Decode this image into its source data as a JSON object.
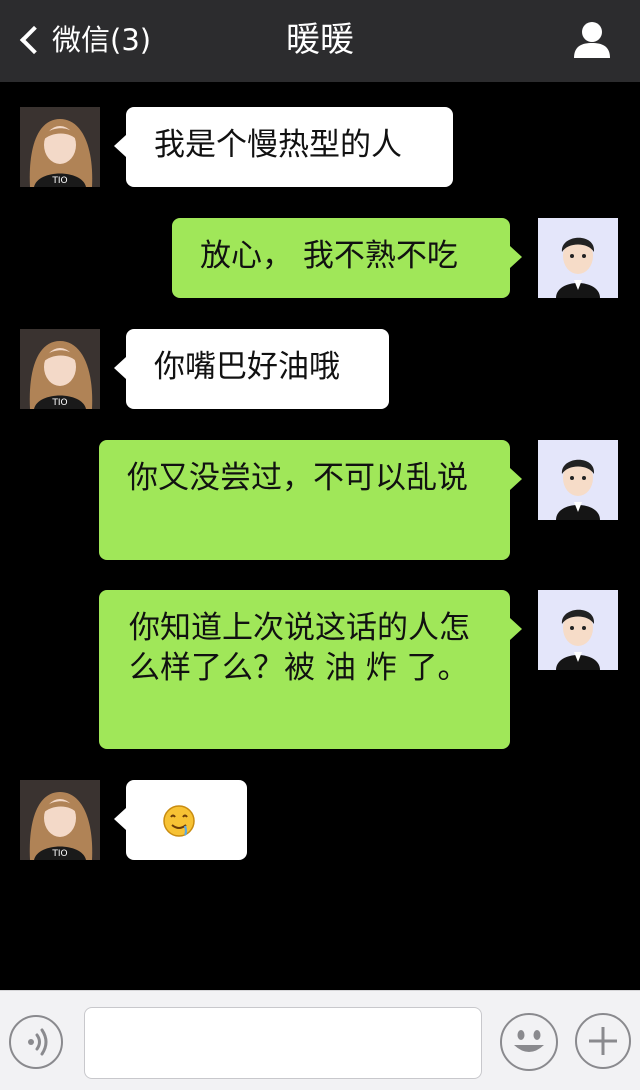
{
  "header": {
    "back_label": "微信(3)",
    "title": "暖暖",
    "profile_icon": "person-icon"
  },
  "messages": [
    {
      "side": "left",
      "text": "我是个慢热型的人"
    },
    {
      "side": "right",
      "text": "放心， 我不熟不吃"
    },
    {
      "side": "left",
      "text": "你嘴巴好油哦"
    },
    {
      "side": "right",
      "text": "你又没尝过，不可以乱说"
    },
    {
      "side": "right",
      "text": "你知道上次说这话的人怎么样了么？被 油 炸 了。"
    },
    {
      "side": "left",
      "emoji": "drooling-face-emoji"
    }
  ],
  "input_bar": {
    "voice_icon": "voice-icon",
    "input_placeholder": "",
    "emoji_icon": "smiley-icon",
    "more_icon": "plus-icon"
  },
  "colors": {
    "navbar": "#2c2c2e",
    "background": "#000000",
    "outgoing_bubble": "#a0e759",
    "incoming_bubble": "#ffffff"
  }
}
